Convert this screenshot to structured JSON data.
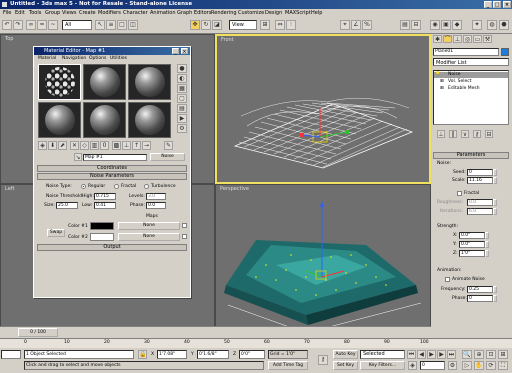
{
  "window": {
    "title": "Untitled - 3ds max 5 - Not for Resale - Stand-alone License",
    "min": "_",
    "max": "□",
    "close": "×"
  },
  "menu": [
    "File",
    "Edit",
    "Tools",
    "Group",
    "Views",
    "Create",
    "Modifiers",
    "Character",
    "Animation",
    "Graph Editors",
    "Rendering",
    "Customize",
    "Design",
    "MAXScript",
    "Help"
  ],
  "toolbar": {
    "selection_filter": "All",
    "reference_coord": "View"
  },
  "viewports": {
    "top": "Top",
    "front": "Front",
    "left": "Left",
    "perspective": "Perspective"
  },
  "material_editor": {
    "title": "Material Editor - Map #1",
    "menu": [
      "Material",
      "Navigation",
      "Options",
      "Utilities"
    ],
    "map_name": "Map #1",
    "map_type": "Noise",
    "rollouts": {
      "coordinates": "Coordinates",
      "noise_params": "Noise Parameters",
      "output": "Output"
    },
    "noise_type_label": "Noise Type:",
    "noise_types": [
      "Regular",
      "Fractal",
      "Turbulence"
    ],
    "noise_threshold_label": "Noise Threshold:",
    "high_label": "High:",
    "high": "0.715",
    "levels_label": "Levels:",
    "levels": "3.0",
    "size_label": "Size:",
    "size": "25.0",
    "low_label": "Low:",
    "low": "0.41",
    "phase_label": "Phase:",
    "phase": "0.0",
    "maps_label": "Maps",
    "color1_label": "Color #1",
    "color2_label": "Color #2",
    "swap": "Swap",
    "none1": "None",
    "none2": "None"
  },
  "command_panel": {
    "object_name": "Plane01",
    "modifier_list": "Modifier List",
    "stack": [
      "Noise",
      "Vol. Select",
      "Editable Mesh"
    ],
    "parameters": "Parameters",
    "noise_group": "Noise:",
    "seed_label": "Seed:",
    "seed": "0",
    "scale_label": "Scale:",
    "scale": "11.16",
    "fractal_label": "Fractal",
    "roughness_label": "Roughness:",
    "roughness": "0.0",
    "iterations_label": "Iterations:",
    "iterations": "6.0",
    "strength_group": "Strength:",
    "x_label": "X:",
    "x": "0.0\"",
    "y_label": "Y:",
    "y": "0.0\"",
    "z_label": "Z:",
    "z": "1'0\"",
    "animation_group": "Animation:",
    "animate_noise": "Animate Noise",
    "frequency_label": "Frequency:",
    "frequency": "0.25",
    "phase_label": "Phase:",
    "phase": "0"
  },
  "timeline": {
    "slider": "0 / 100",
    "ticks": [
      "0",
      "10",
      "20",
      "30",
      "40",
      "50",
      "60",
      "70",
      "80",
      "90",
      "100"
    ]
  },
  "status": {
    "selection": "1 Object Selected",
    "prompt": "Click and drag to select and move objects",
    "x_label": "X",
    "x": "1'7.08\"",
    "y_label": "Y",
    "y": "0'1.6/8\"",
    "z_label": "Z",
    "z": "0'0\"",
    "grid": "Grid = 1'0\"",
    "add_time_tag": "Add Time Tag",
    "auto_key": "Auto Key",
    "set_key": "Set Key",
    "selected": "Selected",
    "key_filters": "Key Filters...",
    "frame": "0"
  }
}
